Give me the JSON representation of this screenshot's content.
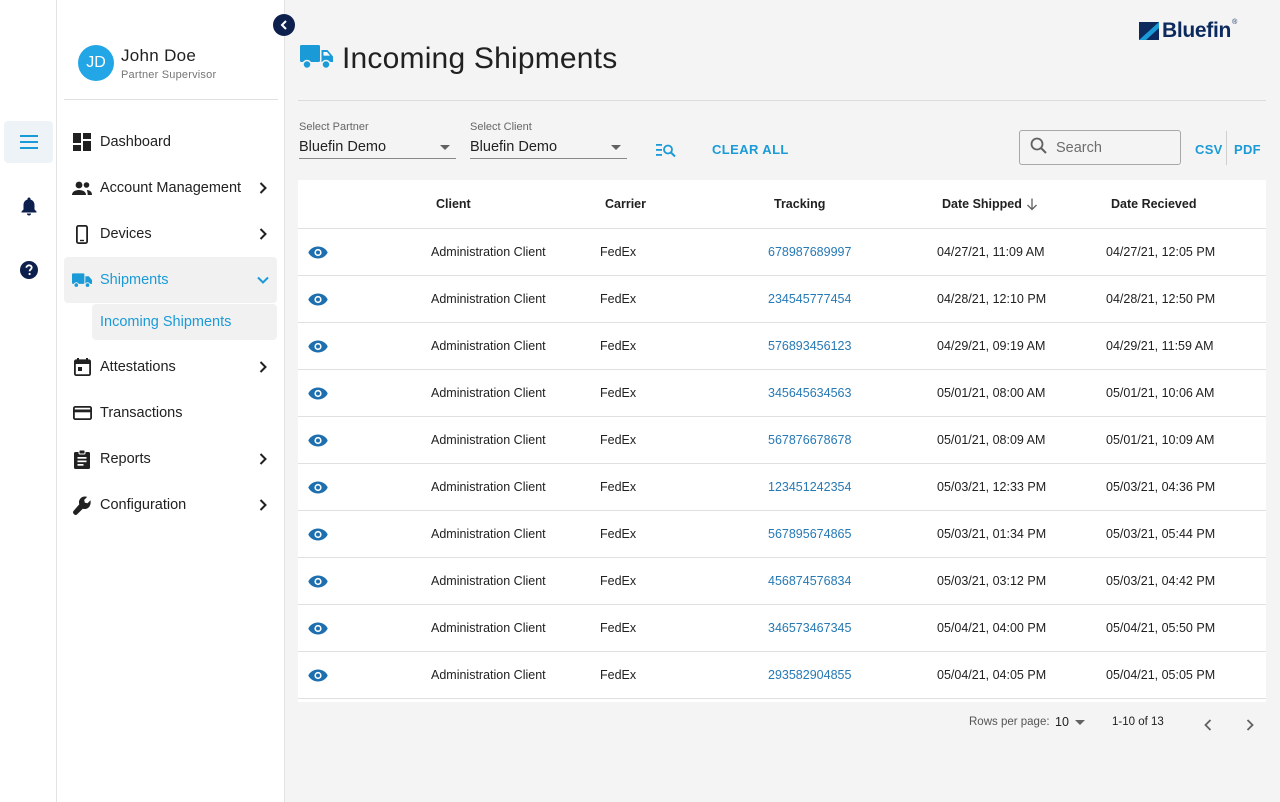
{
  "brand": {
    "name": "Bluefin",
    "reg": "®"
  },
  "user": {
    "initials": "JD",
    "name": "John Doe",
    "role": "Partner Supervisor"
  },
  "nav": {
    "items": [
      {
        "label": "Dashboard",
        "icon": "dashboard-icon",
        "chevron": false
      },
      {
        "label": "Account Management",
        "icon": "people-icon",
        "chevron": true
      },
      {
        "label": "Devices",
        "icon": "phone-icon",
        "chevron": true
      },
      {
        "label": "Shipments",
        "icon": "truck-icon",
        "chevron": true,
        "active": true,
        "expanded": true
      },
      {
        "label": "Attestations",
        "icon": "calendar-icon",
        "chevron": true
      },
      {
        "label": "Transactions",
        "icon": "credit-card-icon",
        "chevron": false
      },
      {
        "label": "Reports",
        "icon": "clipboard-icon",
        "chevron": true
      },
      {
        "label": "Configuration",
        "icon": "wrench-icon",
        "chevron": true
      }
    ],
    "sub_item": "Incoming Shipments"
  },
  "page": {
    "title": "Incoming Shipments",
    "icon": "truck-icon"
  },
  "filters": {
    "partner_label": "Select Partner",
    "partner_value": "Bluefin Demo",
    "client_label": "Select Client",
    "client_value": "Bluefin Demo",
    "clear_label": "CLEAR ALL",
    "search_placeholder": "Search",
    "csv_label": "CSV",
    "pdf_label": "PDF"
  },
  "table": {
    "headers": [
      "Client",
      "Carrier",
      "Tracking",
      "Date Shipped",
      "Date Recieved"
    ],
    "rows": [
      [
        "Administration Client",
        "FedEx",
        "678987689997",
        "04/27/21, 11:09 AM",
        "04/27/21, 12:05 PM"
      ],
      [
        "Administration Client",
        "FedEx",
        "234545777454",
        "04/28/21, 12:10 PM",
        "04/28/21, 12:50 PM"
      ],
      [
        "Administration Client",
        "FedEx",
        "576893456123",
        "04/29/21, 09:19 AM",
        "04/29/21, 11:59 AM"
      ],
      [
        "Administration Client",
        "FedEx",
        "345645634563",
        "05/01/21, 08:00 AM",
        "05/01/21, 10:06 AM"
      ],
      [
        "Administration Client",
        "FedEx",
        "567876678678",
        "05/01/21, 08:09 AM",
        "05/01/21, 10:09 AM"
      ],
      [
        "Administration Client",
        "FedEx",
        "123451242354",
        "05/03/21, 12:33 PM",
        "05/03/21, 04:36 PM"
      ],
      [
        "Administration Client",
        "FedEx",
        "567895674865",
        "05/03/21, 01:34 PM",
        "05/03/21, 05:44 PM"
      ],
      [
        "Administration Client",
        "FedEx",
        "456874576834",
        "05/03/21, 03:12 PM",
        "05/03/21, 04:42 PM"
      ],
      [
        "Administration Client",
        "FedEx",
        "346573467345",
        "05/04/21, 04:00 PM",
        "05/04/21, 05:50 PM"
      ],
      [
        "Administration Client",
        "FedEx",
        "293582904855",
        "05/04/21, 04:05 PM",
        "05/04/21, 05:05 PM"
      ]
    ]
  },
  "pagination": {
    "rows_per_page_label": "Rows per page:",
    "rows_per_page": "10",
    "range": "1-10 of 13"
  },
  "colors": {
    "accent": "#1a9bd7",
    "navy": "#0d1f4c",
    "link": "#2679b5",
    "icon": "#1e6fb0"
  }
}
